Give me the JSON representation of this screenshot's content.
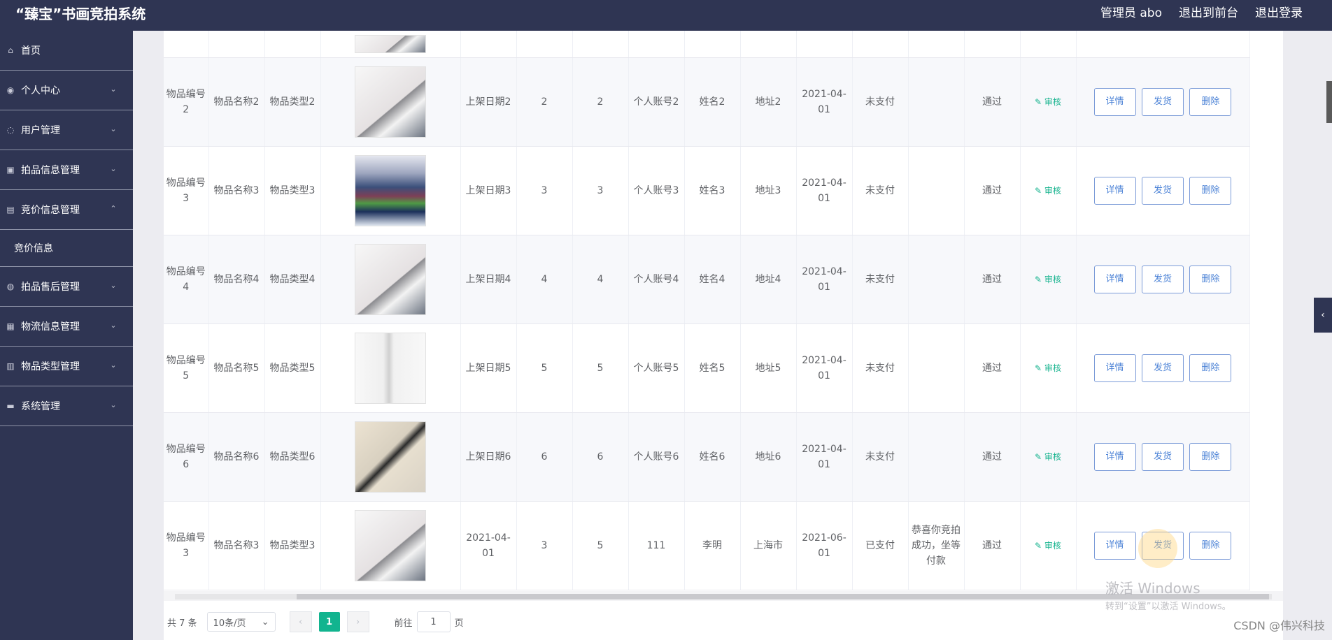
{
  "header": {
    "title": "“臻宝”书画竞拍系统",
    "admin": "管理员 abo",
    "front": "退出到前台",
    "logout": "退出登录"
  },
  "sidebar": {
    "items": [
      {
        "label": "首页"
      },
      {
        "label": "个人中心"
      },
      {
        "label": "用户管理"
      },
      {
        "label": "拍品信息管理"
      },
      {
        "label": "竞价信息管理"
      },
      {
        "label": "竞价信息"
      },
      {
        "label": "拍品售后管理"
      },
      {
        "label": "物流信息管理"
      },
      {
        "label": "物品类型管理"
      },
      {
        "label": "系统管理"
      }
    ]
  },
  "table": {
    "rows": [
      {
        "item_no": "物品编号2",
        "name": "物品名称2",
        "type": "物品类型2",
        "listed": "上架日期2",
        "num1": "2",
        "num2": "2",
        "account": "个人账号2",
        "person": "姓名2",
        "addr": "地址2",
        "date": "2021-04-01",
        "pay": "未支付",
        "note": "",
        "status": "通过",
        "audit": "审核"
      },
      {
        "item_no": "物品编号3",
        "name": "物品名称3",
        "type": "物品类型3",
        "listed": "上架日期3",
        "num1": "3",
        "num2": "3",
        "account": "个人账号3",
        "person": "姓名3",
        "addr": "地址3",
        "date": "2021-04-01",
        "pay": "未支付",
        "note": "",
        "status": "通过",
        "audit": "审核"
      },
      {
        "item_no": "物品编号4",
        "name": "物品名称4",
        "type": "物品类型4",
        "listed": "上架日期4",
        "num1": "4",
        "num2": "4",
        "account": "个人账号4",
        "person": "姓名4",
        "addr": "地址4",
        "date": "2021-04-01",
        "pay": "未支付",
        "note": "",
        "status": "通过",
        "audit": "审核"
      },
      {
        "item_no": "物品编号5",
        "name": "物品名称5",
        "type": "物品类型5",
        "listed": "上架日期5",
        "num1": "5",
        "num2": "5",
        "account": "个人账号5",
        "person": "姓名5",
        "addr": "地址5",
        "date": "2021-04-01",
        "pay": "未支付",
        "note": "",
        "status": "通过",
        "audit": "审核"
      },
      {
        "item_no": "物品编号6",
        "name": "物品名称6",
        "type": "物品类型6",
        "listed": "上架日期6",
        "num1": "6",
        "num2": "6",
        "account": "个人账号6",
        "person": "姓名6",
        "addr": "地址6",
        "date": "2021-04-01",
        "pay": "未支付",
        "note": "",
        "status": "通过",
        "audit": "审核"
      },
      {
        "item_no": "物品编号3",
        "name": "物品名称3",
        "type": "物品类型3",
        "listed": "2021-04-01",
        "num1": "3",
        "num2": "5",
        "account": "111",
        "person": "李明",
        "addr": "上海市",
        "date": "2021-06-01",
        "pay": "已支付",
        "note": "恭喜你竞拍成功，坐等付款",
        "status": "通过",
        "audit": "审核"
      }
    ],
    "actions": {
      "detail": "详情",
      "ship": "发货",
      "delete": "删除"
    }
  },
  "pagination": {
    "total": "共 7 条",
    "page_size": "10条/页",
    "current": "1",
    "goto_label": "前往",
    "goto_value": "1",
    "page_label": "页"
  },
  "overlay": {
    "windows_line1": "激活 Windows",
    "windows_line2": "转到“设置”以激活 Windows。",
    "csdn": "CSDN @伟兴科技"
  }
}
